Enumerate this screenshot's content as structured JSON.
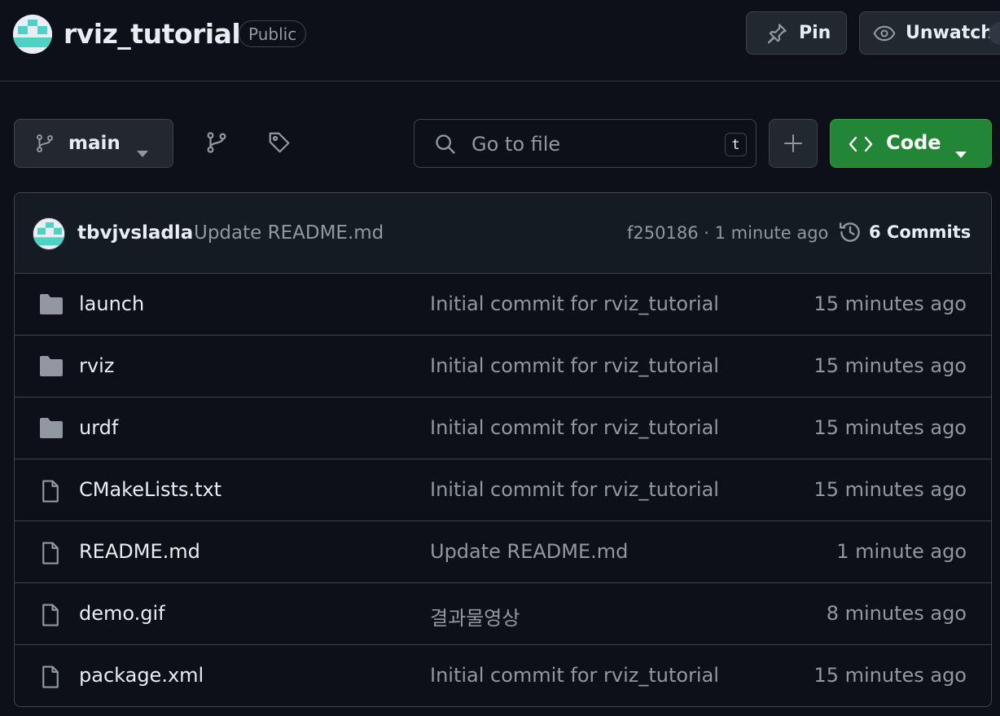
{
  "header": {
    "repo_name": "rviz_tutorial",
    "visibility": "Public",
    "pin_label": "Pin",
    "watch_label": "Unwatch"
  },
  "toolbar": {
    "branch": "main",
    "search_placeholder": "Go to file",
    "search_shortcut": "t",
    "code_label": "Code"
  },
  "latest_commit": {
    "author": "tbvjvsladla",
    "message": "Update README.md",
    "meta": "f250186 · 1 minute ago",
    "commits_label": "6 Commits"
  },
  "files": [
    {
      "type": "folder",
      "name": "launch",
      "message": "Initial commit for rviz_tutorial",
      "time": "15 minutes ago"
    },
    {
      "type": "folder",
      "name": "rviz",
      "message": "Initial commit for rviz_tutorial",
      "time": "15 minutes ago"
    },
    {
      "type": "folder",
      "name": "urdf",
      "message": "Initial commit for rviz_tutorial",
      "time": "15 minutes ago"
    },
    {
      "type": "file",
      "name": "CMakeLists.txt",
      "message": "Initial commit for rviz_tutorial",
      "time": "15 minutes ago"
    },
    {
      "type": "file",
      "name": "README.md",
      "message": "Update README.md",
      "time": "1 minute ago"
    },
    {
      "type": "file",
      "name": "demo.gif",
      "message": "결과물영상",
      "time": "8 minutes ago"
    },
    {
      "type": "file",
      "name": "package.xml",
      "message": "Initial commit for rviz_tutorial",
      "time": "15 minutes ago"
    }
  ],
  "colors": {
    "background": "#0d1117",
    "border": "#3d444d",
    "code_button": "#238636",
    "muted_text": "#9198a1",
    "folder_icon": "#9198a1"
  }
}
